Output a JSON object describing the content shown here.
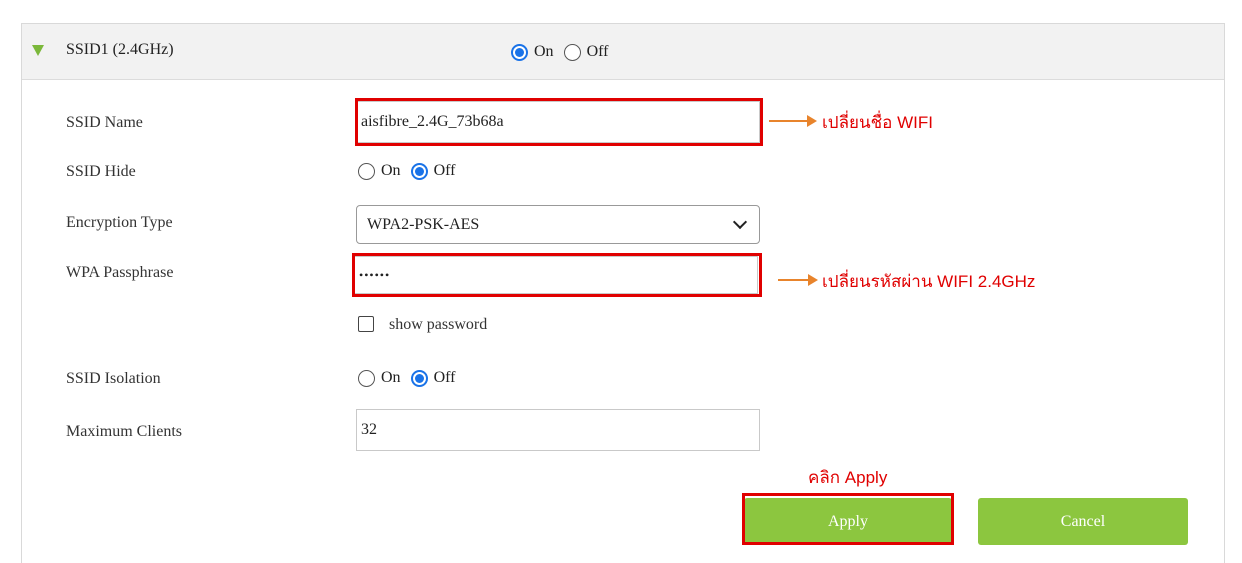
{
  "header": {
    "title": "SSID1 (2.4GHz)",
    "on_label": "On",
    "off_label": "Off",
    "selected": "On"
  },
  "form": {
    "ssid_name": {
      "label": "SSID Name",
      "value": "aisfibre_2.4G_73b68a"
    },
    "ssid_hide": {
      "label": "SSID Hide",
      "on_label": "On",
      "off_label": "Off",
      "selected": "Off"
    },
    "encryption_type": {
      "label": "Encryption Type",
      "value": "WPA2-PSK-AES"
    },
    "wpa_passphrase": {
      "label": "WPA Passphrase",
      "value": "••••••"
    },
    "show_password": {
      "label": "show password",
      "checked": false
    },
    "ssid_isolation": {
      "label": "SSID Isolation",
      "on_label": "On",
      "off_label": "Off",
      "selected": "Off"
    },
    "maximum_clients": {
      "label": "Maximum Clients",
      "value": "32"
    }
  },
  "buttons": {
    "apply": "Apply",
    "cancel": "Cancel"
  },
  "annotations": {
    "change_name": "เปลี่ยนชื่อ WIFI",
    "change_password": "เปลี่ยนรหัสผ่าน WIFI 2.4GHz",
    "click_apply": "คลิก Apply"
  },
  "colors": {
    "accent_green": "#8cc63f",
    "highlight_red": "#e00000",
    "arrow_orange": "#e8842c",
    "radio_blue": "#1a73e8"
  }
}
